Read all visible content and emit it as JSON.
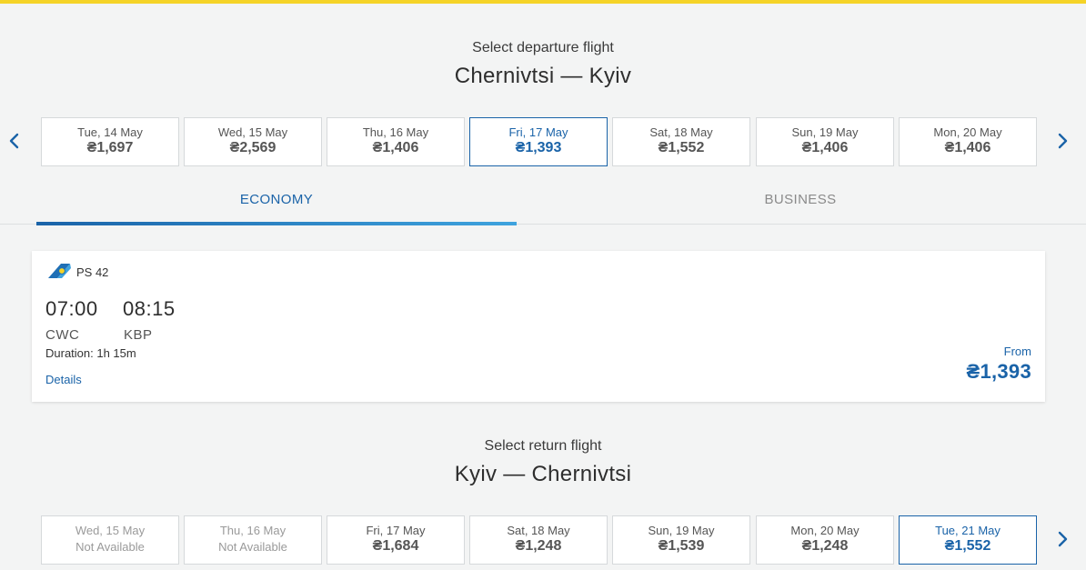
{
  "departure": {
    "subtitle": "Select departure flight",
    "route": "Chernivtsi — Kyiv",
    "dates": [
      {
        "label": "Tue, 14 May",
        "price": "₴1,697",
        "selected": false
      },
      {
        "label": "Wed, 15 May",
        "price": "₴2,569",
        "selected": false
      },
      {
        "label": "Thu, 16 May",
        "price": "₴1,406",
        "selected": false
      },
      {
        "label": "Fri, 17 May",
        "price": "₴1,393",
        "selected": true
      },
      {
        "label": "Sat, 18 May",
        "price": "₴1,552",
        "selected": false
      },
      {
        "label": "Sun, 19 May",
        "price": "₴1,406",
        "selected": false
      },
      {
        "label": "Mon, 20 May",
        "price": "₴1,406",
        "selected": false
      }
    ]
  },
  "tabs": {
    "economy": "ECONOMY",
    "business": "BUSINESS",
    "active": "economy"
  },
  "flight": {
    "airline_logo_icon": "uia-logo-icon",
    "number": "PS 42",
    "depart_time": "07:00",
    "arrive_time": "08:15",
    "depart_code": "CWC",
    "arrive_code": "KBP",
    "duration": "Duration: 1h 15m",
    "details_label": "Details",
    "from_label": "From",
    "from_price": "₴1,393"
  },
  "return": {
    "subtitle": "Select return flight",
    "route": "Kyiv — Chernivtsi",
    "dates": [
      {
        "label": "Wed, 15 May",
        "price": "Not Available",
        "selected": false,
        "available": false
      },
      {
        "label": "Thu, 16 May",
        "price": "Not Available",
        "selected": false,
        "available": false
      },
      {
        "label": "Fri, 17 May",
        "price": "₴1,684",
        "selected": false,
        "available": true
      },
      {
        "label": "Sat, 18 May",
        "price": "₴1,248",
        "selected": false,
        "available": true
      },
      {
        "label": "Sun, 19 May",
        "price": "₴1,539",
        "selected": false,
        "available": true
      },
      {
        "label": "Mon, 20 May",
        "price": "₴1,248",
        "selected": false,
        "available": true
      },
      {
        "label": "Tue, 21 May",
        "price": "₴1,552",
        "selected": true,
        "available": true
      }
    ]
  },
  "colors": {
    "accent": "#1a63a8",
    "top_bar": "#f5d327",
    "background": "#f3f4f4"
  }
}
